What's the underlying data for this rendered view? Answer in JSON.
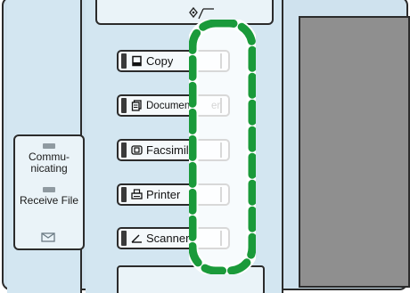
{
  "status_panel": {
    "communicating_label": "Commu-\nnicating",
    "communicating_line1": "Commu-",
    "communicating_line2": "nicating",
    "receive_file_label": "Receive File"
  },
  "function_keys": [
    {
      "label": "Copy",
      "icon": "copy-icon"
    },
    {
      "label": "Document",
      "suffix": "er",
      "icon": "document-server-icon"
    },
    {
      "label": "Facsimil",
      "icon": "facsimile-icon"
    },
    {
      "label": "Printer",
      "icon": "printer-icon"
    },
    {
      "label": "Scanner",
      "icon": "scanner-icon"
    }
  ],
  "colors": {
    "panel": "#d3e6f1",
    "highlight": "#1a9a3a",
    "screen": "#8f8f8f"
  }
}
